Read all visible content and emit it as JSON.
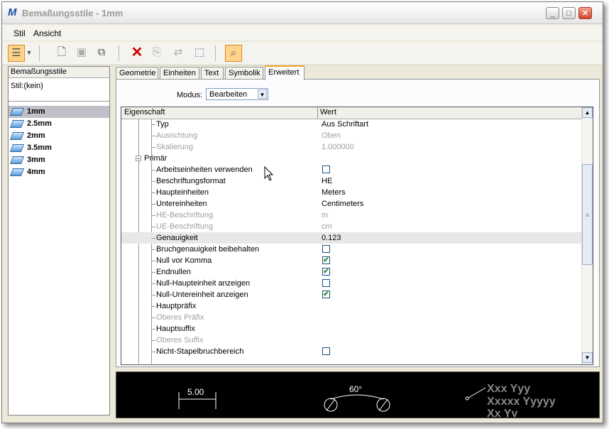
{
  "window": {
    "title": "Bemaßungsstile -  1mm",
    "controls": [
      "minimize",
      "maximize",
      "close"
    ]
  },
  "menu": {
    "items": [
      {
        "label": "Stil",
        "accel": "S"
      },
      {
        "label": "Ansicht",
        "accel": "A"
      }
    ]
  },
  "toolbar": {
    "icons": [
      "tree-view-icon",
      "dropdown-arrow-icon",
      "new-style-icon",
      "save-icon",
      "copy-icon",
      "delete-icon",
      "copy-values-icon",
      "transfer-icon",
      "import-icon",
      "preview-toggle-icon"
    ]
  },
  "left": {
    "header": "Bemaßungsstile",
    "stil": "Stil:(kein)",
    "styles": [
      "1mm",
      "2.5mm",
      "2mm",
      "3.5mm",
      "3mm",
      "4mm"
    ],
    "selected": "1mm"
  },
  "tabs": [
    {
      "label": "Geometrie"
    },
    {
      "label": "Einheiten"
    },
    {
      "label": "Text"
    },
    {
      "label": "Symbolik"
    },
    {
      "label": "Erweitert"
    }
  ],
  "active_tab": "Erweitert",
  "modus": {
    "label": "Modus:",
    "value": "Bearbeiten"
  },
  "grid": {
    "col_property": "Eigenschaft",
    "col_value": "Wert",
    "rows": [
      {
        "name": "Typ",
        "value": "Aus Schriftart",
        "kind": "text",
        "disabled": false
      },
      {
        "name": "Ausrichtung",
        "value": "Oben",
        "kind": "text",
        "disabled": true
      },
      {
        "name": "Skalierung",
        "value": "1.000000",
        "kind": "text",
        "disabled": true
      },
      {
        "name": "Primär",
        "value": "",
        "kind": "section",
        "disabled": false
      },
      {
        "name": "Arbeitseinheiten verwenden",
        "value": "",
        "kind": "check",
        "checked": false,
        "disabled": false
      },
      {
        "name": "Beschriftungsformat",
        "value": "HE",
        "kind": "text",
        "disabled": false
      },
      {
        "name": "Haupteinheiten",
        "value": "Meters",
        "kind": "text",
        "disabled": false
      },
      {
        "name": "Untereinheiten",
        "value": "Centimeters",
        "kind": "text",
        "disabled": false
      },
      {
        "name": "HE-Beschriftung",
        "value": "m",
        "kind": "text",
        "disabled": true
      },
      {
        "name": "UE-Beschriftung",
        "value": "cm",
        "kind": "text",
        "disabled": true
      },
      {
        "name": "Genauigkeit",
        "value": "0.123",
        "kind": "text",
        "disabled": false,
        "highlight": true
      },
      {
        "name": "Bruchgenauigkeit beibehalten",
        "value": "",
        "kind": "check",
        "checked": false,
        "disabled": false
      },
      {
        "name": "Null vor Komma",
        "value": "",
        "kind": "check",
        "checked": true,
        "disabled": false
      },
      {
        "name": "Endnullen",
        "value": "",
        "kind": "check",
        "checked": true,
        "disabled": false
      },
      {
        "name": "Null-Haupteinheit anzeigen",
        "value": "",
        "kind": "check",
        "checked": false,
        "disabled": false
      },
      {
        "name": "Null-Untereinheit anzeigen",
        "value": "",
        "kind": "check",
        "checked": true,
        "disabled": false
      },
      {
        "name": "Hauptpräfix",
        "value": "",
        "kind": "text",
        "disabled": false
      },
      {
        "name": "Oberes Präfix",
        "value": "",
        "kind": "text",
        "disabled": true
      },
      {
        "name": "Hauptsuffix",
        "value": "",
        "kind": "text",
        "disabled": false
      },
      {
        "name": "Oberes Suffix",
        "value": "",
        "kind": "text",
        "disabled": true
      },
      {
        "name": "Nicht-Stapelbruchbereich",
        "value": "",
        "kind": "check",
        "checked": false,
        "disabled": false
      }
    ]
  },
  "preview": {
    "linear_value": "5.00",
    "angle_value": "60°",
    "note_lines": [
      "Xxx Yyy",
      "Xxxxx Yyyyy",
      "Xx Yy"
    ]
  }
}
